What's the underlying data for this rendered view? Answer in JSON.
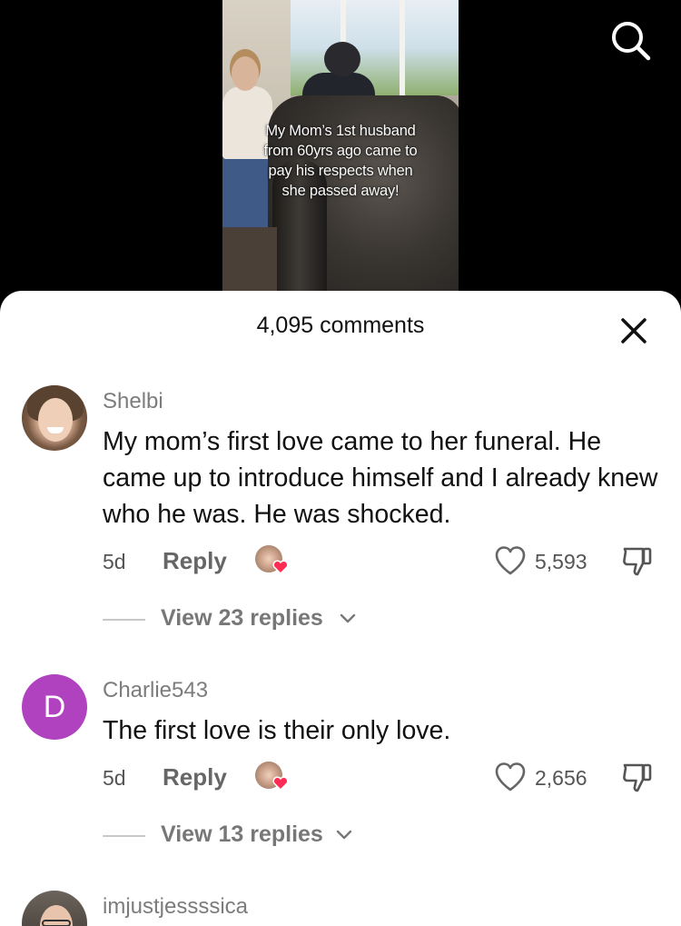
{
  "video": {
    "caption_lines": [
      "My Mom’s 1st husband",
      "from 60yrs ago came to",
      "pay his respects when",
      "she passed away!"
    ]
  },
  "icons": {
    "search": "search-icon",
    "close": "close-icon",
    "like": "heart-outline-icon",
    "dislike": "thumbs-down-icon",
    "chevron": "chevron-down-icon",
    "creator_heart": "red-heart-icon"
  },
  "colors": {
    "sheet_bg": "#ffffff",
    "heart_red": "#fe2c55",
    "avatar_purple": "#b042c0"
  },
  "sheet": {
    "comment_count": "4,095 comments"
  },
  "comments": [
    {
      "username": "Shelbi",
      "text": "My mom’s first love came to her funeral. He came up to introduce himself and I already knew who he was. He was shocked.",
      "time": "5d",
      "reply_label": "Reply",
      "likes": "5,593",
      "replies_label": "View 23 replies"
    },
    {
      "username": "Charlie543",
      "avatar_letter": "D",
      "text": "The first love is their only love.",
      "time": "5d",
      "reply_label": "Reply",
      "likes": "2,656",
      "replies_label": "View 13 replies"
    },
    {
      "username": "imjustjessssica"
    }
  ]
}
